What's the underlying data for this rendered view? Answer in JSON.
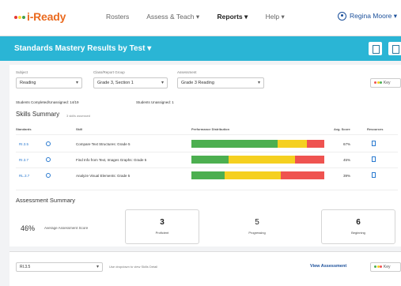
{
  "brand": {
    "text": "i-Ready",
    "dots": [
      "#e53935",
      "#fdd835",
      "#43a047"
    ]
  },
  "nav": {
    "items": [
      {
        "label": "Rosters",
        "active": false
      },
      {
        "label": "Assess & Teach ▾",
        "active": false
      },
      {
        "label": "Reports ▾",
        "active": true
      },
      {
        "label": "Help ▾",
        "active": false
      }
    ],
    "user": "Regina Moore ▾"
  },
  "title": {
    "text": "Standards Mastery Results by Test ▾"
  },
  "filters": {
    "subject": {
      "label": "Subject",
      "value": "Reading"
    },
    "class": {
      "label": "Class/Report Group",
      "value": "Grade 3, Section 1"
    },
    "assessment": {
      "label": "Assessment",
      "value": "Grade 3 Reading"
    },
    "key_label": "Key"
  },
  "stats": {
    "completed": "Students Completed/Unassigned: 14/19",
    "unassigned": "Students Unassigned: 1"
  },
  "skills": {
    "title": "Skills Summary",
    "subtitle": "3 skills assessed",
    "headers": {
      "standards": "Standards",
      "skill": "Skill",
      "performance": "Performance Distribution",
      "avg_score": "Avg. Score",
      "resources": "Resources"
    },
    "rows": [
      {
        "standard": "RI.3.5",
        "skill": "Compare Text Structures: Grade 5",
        "avg": "67%",
        "dist": [
          0.65,
          0.22,
          0.13
        ]
      },
      {
        "standard": "RI.3.7",
        "skill": "Find Info from Text, Images Graphs: Grade 5",
        "avg": "45%",
        "dist": [
          0.28,
          0.5,
          0.22
        ]
      },
      {
        "standard": "RL.3.7",
        "skill": "Analyze Visual Elements: Grade 5",
        "avg": "39%",
        "dist": [
          0.25,
          0.42,
          0.33
        ]
      }
    ],
    "colors": {
      "proficient": "#4caf50",
      "progressing": "#f5d020",
      "beginning": "#ef5350"
    }
  },
  "assessment_summary": {
    "title": "Assessment Summary",
    "avg_pct": "46%",
    "avg_label": "Average Assessment Score",
    "proficient": {
      "count": "3",
      "label": "Proficient"
    },
    "progressing": {
      "count": "5",
      "label": "Progressing"
    },
    "beginning": {
      "count": "6",
      "label": "Beginning"
    }
  },
  "footer": {
    "standard": "RI.3.5",
    "hint": "Use dropdown to view Skills Detail",
    "view_assessment": "View Assessment",
    "key_label": "Key"
  }
}
